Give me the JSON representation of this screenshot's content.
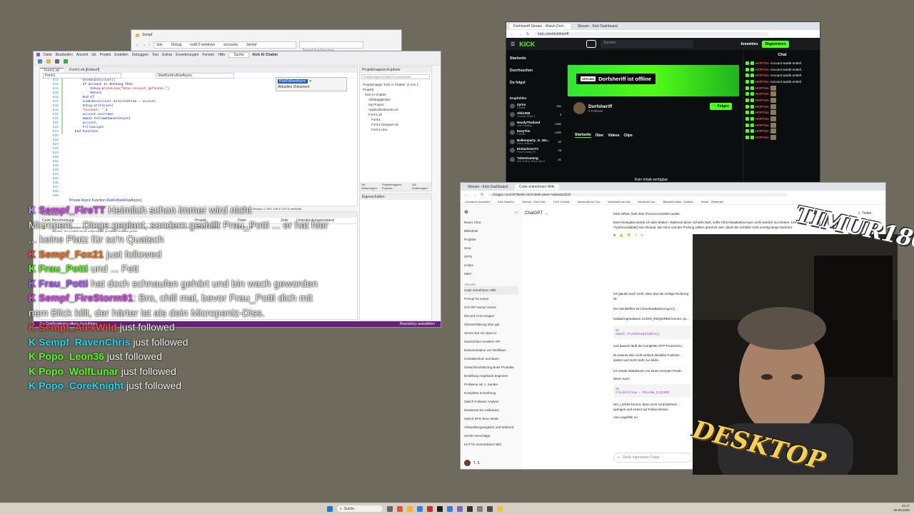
{
  "file_explorer": {
    "title": "Sempf",
    "crumbs": [
      "bdv",
      "Debug",
      "net8.0-windows",
      "accounts",
      "Sempf"
    ],
    "search_placeholder": "Sempf durchsuchen"
  },
  "vs": {
    "menus": [
      "Datei",
      "Bearbeiten",
      "Ansicht",
      "Git",
      "Projekt",
      "Erstellen",
      "Debuggen",
      "Test",
      "Extras",
      "Erweiterungen",
      "Fenster",
      "Hilfe"
    ],
    "search": "Suche",
    "solution_name": "Kick AI Chatter",
    "tabs": [
      "Form1.vb",
      "Form1.vb [Entwurf]"
    ],
    "dropdown_left": "Form1",
    "dropdown_right": "StartKickFollowAsync",
    "find_value": "KickFollowAsync",
    "find_scope": "Aktuelles Dokument",
    "line_numbers": [
      "612",
      "613",
      "614",
      "615",
      "616",
      "617",
      "618",
      "619",
      "620",
      "621",
      "622",
      "623",
      "624",
      "625",
      "626",
      "627",
      "628",
      "629",
      "630",
      "631",
      "632",
      "633",
      "634",
      "635",
      "636",
      "637",
      "638",
      "639"
    ],
    "code_lines": [
      "        GetHandsAccount()",
      "",
      "        If account Is Nothing Then",
      "",
      "            Debug.WriteLine(\"Kein Account gefunden.\")",
      "            Return",
      "",
      "        End If",
      "",
      "        ComboBoxAccount.SelectedItem = account",
      "",
      "        Debug.WriteLine(",
      "        \"Account: \" &",
      "        account.Username",
      "",
      "",
      "        Await FollowChannelAsync(",
      "        account,",
      "        FollowLogin",
      "",
      "",
      "    End Function",
      "",
      "",
      "",
      "",
      "",
      ""
    ],
    "code_footer": "Private Async Function RunFollowFlowAsync(",
    "status_bar": "Zeile: 30  Zeichen: 1  SPC  CRLF  UTF-8 mit BOM",
    "explorer_title": "Projektmappen-Explorer",
    "explorer_search": "Projektmappen-Explorer durchsuchen",
    "explorer_items": [
      "Projektmappe 'Kick AI Chatter' (1 von 1 Projekt)",
      "Kick AI Chatter",
      "Abhängigkeiten",
      "My Project",
      "ApplicationEvents.vb",
      "Form1.vb",
      "Form1",
      "Form1.Designer.vb",
      "Form1.resx"
    ],
    "explorer_tabs": [
      "Git-Änderungen",
      "Projektmappen-Explorer",
      "Git-Änderungen"
    ],
    "props_title": "Eigenschaften",
    "error_title": "Fehlerliste",
    "error_cols": [
      "Code",
      "Beschreibung",
      "Projekt",
      "Datei",
      "Zeile",
      "Unterdrückungszustand"
    ],
    "error_row_project": "Kick AI Chatter",
    "error_row_file": "Form1.vb",
    "error_text": "Konfliktwarnung zwischen verschiedenen Versionen von System.Windows.Forms, die nicht aufgelöst werden konnten. Der Konflikt wurde aufgrund der primären Verweise gelöst.",
    "bottom_status": "Zur Quellcodeverwaltung hinzufügen",
    "bottom_status_right": "Repository auswählen"
  },
  "chat_overlay": [
    {
      "user": "Sempf_FireTT",
      "user_color": "#d946ef",
      "icon_color": "#c084fc",
      "text": " Heimlich schon immer wird nicht "
    },
    {
      "user": "",
      "user_color": "#fff",
      "icon_color": "",
      "text": "Micropeni... Dinge geplant, sondern gechillt Frau_Potti ... er hat hier ... keine Platz für so'n Quatsch"
    },
    {
      "user": "Sempf_Fox21",
      "user_color": "#f97316",
      "icon_color": "#ef4444",
      "text": " just followed"
    },
    {
      "user": "Frau_Potti",
      "user_color": "#53fc18",
      "icon_color": "#53fc18",
      "text": " und ... Fett"
    },
    {
      "user": "Frau_Potti",
      "user_color": "#a855f7",
      "icon_color": "#a855f7",
      "text": " hat doch schnaufen gehört und bin wach geworden"
    },
    {
      "user": "Sempf_FireStorm91",
      "user_color": "#d946ef",
      "icon_color": "#d946ef",
      "text": ": Bro, chill mal, bevor Frau_Potti dich mit nem Blick killt, der härter ist als dein Micropeniz-Diss."
    },
    {
      "user": "Sempf_AlexWild",
      "user_color": "#ef4444",
      "icon_color": "#ef4444",
      "text": " just followed"
    },
    {
      "user": "Sempf_RavenChris",
      "user_color": "#22d3ee",
      "icon_color": "#22d3ee",
      "text": " just followed"
    },
    {
      "user": "Popo_Leon36",
      "user_color": "#53fc18",
      "icon_color": "#53fc18",
      "text": " just followed"
    },
    {
      "user": "Popo_WolfLunar",
      "user_color": "#53fc18",
      "icon_color": "#53fc18",
      "text": " just followed"
    },
    {
      "user": "Popo_CoreKnight",
      "user_color": "#22d3ee",
      "icon_color": "#22d3ee",
      "text": " just followed"
    }
  ],
  "kick_browser": {
    "tab1": "Dorfsheriff Stream - Watch Dorf...",
    "tab2": "Stream - Kick Dashboard",
    "url": "kick.com/dorfsheriff",
    "logo": "KICK",
    "search_placeholder": "Suchen",
    "login": "Anmelden",
    "register": "Registrieren",
    "nav": [
      "Startseite",
      "Durchsuchen",
      "Du folgst"
    ],
    "recommended_title": "Empfohlen",
    "recommended": [
      {
        "name": "Zyrim",
        "game": "Fortnite",
        "viewers": "141"
      },
      {
        "name": "Alki1065",
        "game": "Counter-Strike 2",
        "viewers": "3"
      },
      {
        "name": "HandyThailand",
        "game": "Just Chatting",
        "viewers": "LIVE"
      },
      {
        "name": "EasyTim",
        "game": "Fortnite",
        "viewers": "LIVE"
      },
      {
        "name": "Balkonparty_in_Wa...",
        "game": "Music Stations",
        "viewers": "32"
      },
      {
        "name": "EinfachOurTV",
        "game": "Final Fantasy VII",
        "viewers": "23"
      },
      {
        "name": "TxbeeGaming",
        "game": "Call of Duty: Black Ops 6",
        "viewers": "21"
      }
    ],
    "offline_badge": "OFFLINE",
    "offline_text": "Dorfsheriff ist offline",
    "channel_name": "Dorfsheriff",
    "followers": "0 Follower",
    "follow_button": "Folgen",
    "channel_tabs": [
      "Startseite",
      "Über",
      "Videos",
      "Clips"
    ],
    "no_content": "Kein Inhalt verfügbar",
    "chat_title": "Chat",
    "chat_rows": [
      {
        "user": "HOP72m",
        "msg": "Account wurde erstell."
      },
      {
        "user": "HOP72m",
        "msg": "Account wurde erstell."
      },
      {
        "user": "HOP72m",
        "msg": "Account wurde erstell."
      },
      {
        "user": "HOP72m",
        "msg": "Account wurde erstell."
      },
      {
        "user": "HOP72m",
        "msg": ""
      },
      {
        "user": "HOP72m",
        "msg": ""
      },
      {
        "user": "HOP72m",
        "msg": ""
      },
      {
        "user": "HOP72m",
        "msg": ""
      },
      {
        "user": "HOP72m",
        "msg": ""
      },
      {
        "user": "HOP72m",
        "msg": ""
      },
      {
        "user": "HOP72m",
        "msg": ""
      },
      {
        "user": "HOP72m",
        "msg": ""
      },
      {
        "user": "HOP72m",
        "msg": ""
      }
    ]
  },
  "chatgpt_browser": {
    "tab1": "Stream - Kick Dashboard",
    "tab2": "Code entnehmen Hilfe",
    "url": "chatgpt.com/c/67f6e90-40c6-8568-a8e9-7a6b6da1f230",
    "bookmarks": [
      "Leonardo Importiert...",
      "Kick Dashbo...",
      "Stream - Kick Das...",
      "LIVE Central...",
      "Mindcraft von Tac...",
      "Mindcraft von Ma...",
      "Mindcraft von...",
      "Blitzlicht Mobil - Datenb...",
      "Home - Restream"
    ],
    "model": "ChatGPT",
    "share": "Teilen",
    "sidebar_top": [
      "Neuer Chat",
      "Bibliothek",
      "Projekte",
      "Sora",
      "GPTs",
      "Codex",
      "Mehr"
    ],
    "sidebar_section": "Aktuelle",
    "sidebar_chats": [
      "Code entnehmen Hilfe",
      "Prompt für Kanal",
      "GTA RP Humor Szene",
      "Discord CAD Images",
      "Stresserklärung über gpt",
      "Server Bot mit OpenAI",
      "Nachrichten erstellen API",
      "Dokumentation von Welfdiam",
      "Kontaktschutz und Bann",
      "Gewichtsschätzung Bose Produkte",
      "Erstellung Angebauh beginnen",
      "Probleme mit 1. Sender",
      "Komplette Schreibung",
      "Switch Follower Analyse",
      "Erweiterte Eis Kalkulatur",
      "Switch RPG Boss Mode",
      "Abhandlungsangebot und Widerruf",
      "Schritt Vorschläge",
      "KUT für unmerkbaren Bild"
    ],
    "user": "T. S.",
    "msg_top": "Klick Offset, läuft dein Prozess trotzdem weiter.",
    "msg_1": "Eine Kleinigkeit würde ich aber ändern: Während diese Schleife läuft, sollte ClickAllowButtonAsync nicht wirklich nur klicken. Keine Login-Prüfung, kein TrySetAvailable() kein Reload. Der Klick und der Prüfung sollten getrennt sein, damit die Schleife nicht unnötig lange blockiert.",
    "msg_2": "Ich glaube auch nicht, dass das die richtige Richtung ist.",
    "msg_3": "Der Denkfehler ist ClickAllowButtonAsync() ...",
    "msg_4": "Sobald irgendwann LOGIN_REQUIRED kommt, sp...",
    "code_lang": "vb",
    "code_1": "Await TrySetAvailable()",
    "msg_5": "und danach läuft der komplette OTP-Prozess ko...",
    "msg_6": "Du kannst also nicht einfach dieselbe Funktion ... ändert und nicht mehr nur klickt.",
    "msg_7": "Ich würde stattdessen nur einen einzigen Punkt...",
    "msg_8": "Wenn nach",
    "code_2": "ClickFollow = FOLLOW_CLICKED",
    "msg_9": "NO_LOGIN kommt, dann nicht zurückkehren ... springen und erneut auf Follow klicken.",
    "msg_10": "Also ungefähr so:",
    "composer_placeholder": "Stelle irgendeine Frage"
  },
  "webcam": {
    "top_label": "TIMUR1804",
    "bottom_label": "DESKTOP"
  },
  "taskbar": {
    "search": "Suche",
    "time": "19:17",
    "date": "06.08.2026"
  }
}
